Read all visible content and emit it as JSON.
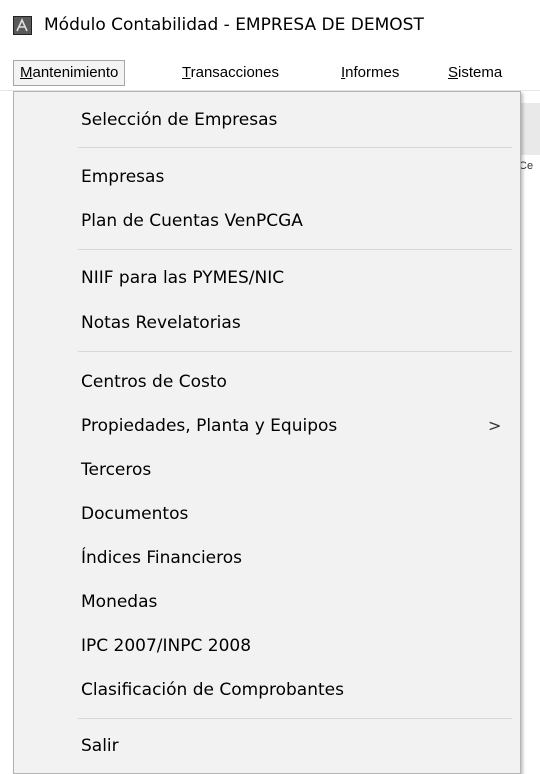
{
  "window": {
    "title": "Módulo Contabilidad - EMPRESA DE DEMOST",
    "icon": "app-logo-icon"
  },
  "menubar": {
    "items": [
      {
        "label": "Mantenimiento",
        "mnemonic": "M",
        "rest": "antenimiento",
        "open": true
      },
      {
        "label": "Transacciones",
        "mnemonic": "T",
        "rest": "ransacciones"
      },
      {
        "label": "Informes",
        "mnemonic": "I",
        "rest": "nformes"
      },
      {
        "label": "Sistema",
        "mnemonic": "S",
        "rest": "istema"
      }
    ]
  },
  "background": {
    "toolbar_fragment": "Ce"
  },
  "dropdown": {
    "items": [
      {
        "label": "Selección de Empresas"
      },
      {
        "label": "Empresas"
      },
      {
        "label": "Plan de Cuentas VenPCGA"
      },
      {
        "label": "NIIF para las PYMES/NIC"
      },
      {
        "label": "Notas Revelatorias"
      },
      {
        "label": "Centros de Costo"
      },
      {
        "label": "Propiedades, Planta y Equipos",
        "submenu_arrow": ">"
      },
      {
        "label": "Terceros"
      },
      {
        "label": "Documentos"
      },
      {
        "label": "Índices Financieros"
      },
      {
        "label": "Monedas"
      },
      {
        "label": "IPC 2007/INPC 2008"
      },
      {
        "label": "Clasificación de Comprobantes"
      },
      {
        "label": "Salir"
      }
    ]
  }
}
